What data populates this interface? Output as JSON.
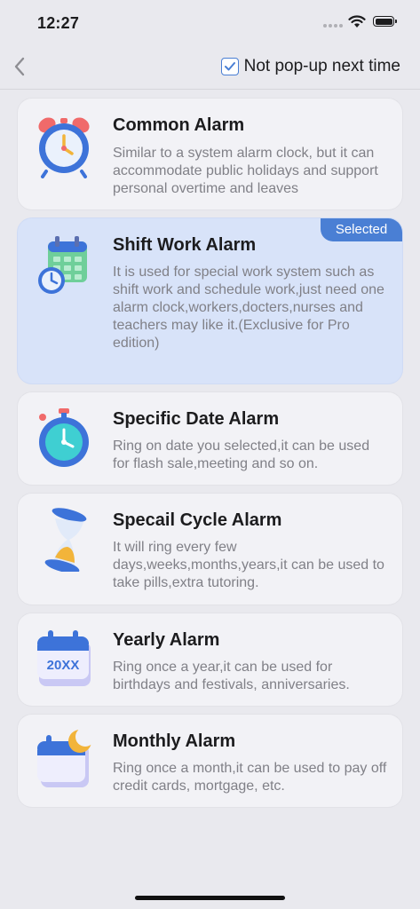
{
  "status": {
    "time": "12:27"
  },
  "nav": {
    "not_popup_label": "Not pop-up next time",
    "not_popup_checked": true
  },
  "alarms": [
    {
      "title": "Common Alarm",
      "description": "Similar to a system alarm clock, but it can accommodate public holidays and support personal overtime and leaves",
      "icon": "alarm-clock-icon"
    },
    {
      "title": "Shift Work Alarm",
      "description": "It is used for special work system such as shift work and schedule work,just need one alarm clock,workers,docters,nurses and teachers may like it.(Exclusive for Pro edition)",
      "icon": "calendar-clock-icon",
      "badge": "Selected"
    },
    {
      "title": "Specific Date Alarm",
      "description": "Ring on date you selected,it can be used for flash sale,meeting and so on.",
      "icon": "stopwatch-icon"
    },
    {
      "title": "Specail Cycle Alarm",
      "description": "It will ring every few days,weeks,months,years,it can be used to take pills,extra tutoring.",
      "icon": "hourglass-icon"
    },
    {
      "title": "Yearly Alarm",
      "description": "Ring once a year,it can be used for birthdays and festivals, anniversaries.",
      "icon": "yearly-calendar-icon",
      "icon_text": "20XX"
    },
    {
      "title": "Monthly Alarm",
      "description": "Ring once a month,it can be used to pay off credit cards, mortgage, etc.",
      "icon": "moon-calendar-icon"
    }
  ],
  "colors": {
    "accent": "#4a7fd4",
    "selected_card": "#d8e3f9",
    "card": "#f2f2f6",
    "background": "#e9e9ee"
  }
}
